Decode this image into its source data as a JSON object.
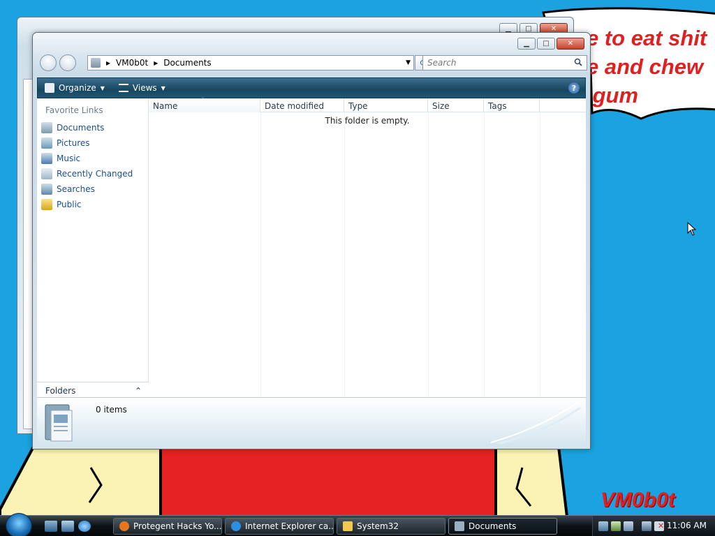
{
  "desktop": {
    "bubble_text": "e to eat shit\ne and chew\n gum",
    "signature": "VM0b0t"
  },
  "window": {
    "breadcrumb": [
      "VM0b0t",
      "Documents"
    ],
    "search_placeholder": "Search",
    "toolbar": {
      "organize": "Organize",
      "views": "Views"
    },
    "sidebar": {
      "title": "Favorite Links",
      "links": [
        {
          "label": "Documents",
          "icon": "documents-icon"
        },
        {
          "label": "Pictures",
          "icon": "pictures-icon"
        },
        {
          "label": "Music",
          "icon": "music-icon"
        },
        {
          "label": "Recently Changed",
          "icon": "recently-changed-icon"
        },
        {
          "label": "Searches",
          "icon": "searches-icon"
        },
        {
          "label": "Public",
          "icon": "public-folder-icon"
        }
      ],
      "folders_label": "Folders"
    },
    "columns": [
      "Name",
      "Date modified",
      "Type",
      "Size",
      "Tags"
    ],
    "empty_text": "This folder is empty.",
    "details": {
      "count": "0 items"
    }
  },
  "taskbar": {
    "tasks": [
      {
        "label": "Protegent Hacks Yo...",
        "icon": "firefox-icon",
        "color": "#e8761c"
      },
      {
        "label": "Internet Explorer ca...",
        "icon": "ie-icon",
        "color": "#2d8fe0"
      },
      {
        "label": "System32",
        "icon": "folder-icon",
        "color": "#f2c94c"
      },
      {
        "label": "Documents",
        "icon": "documents-icon",
        "color": "#9ab0c0"
      }
    ],
    "clock": "11:06 AM"
  }
}
